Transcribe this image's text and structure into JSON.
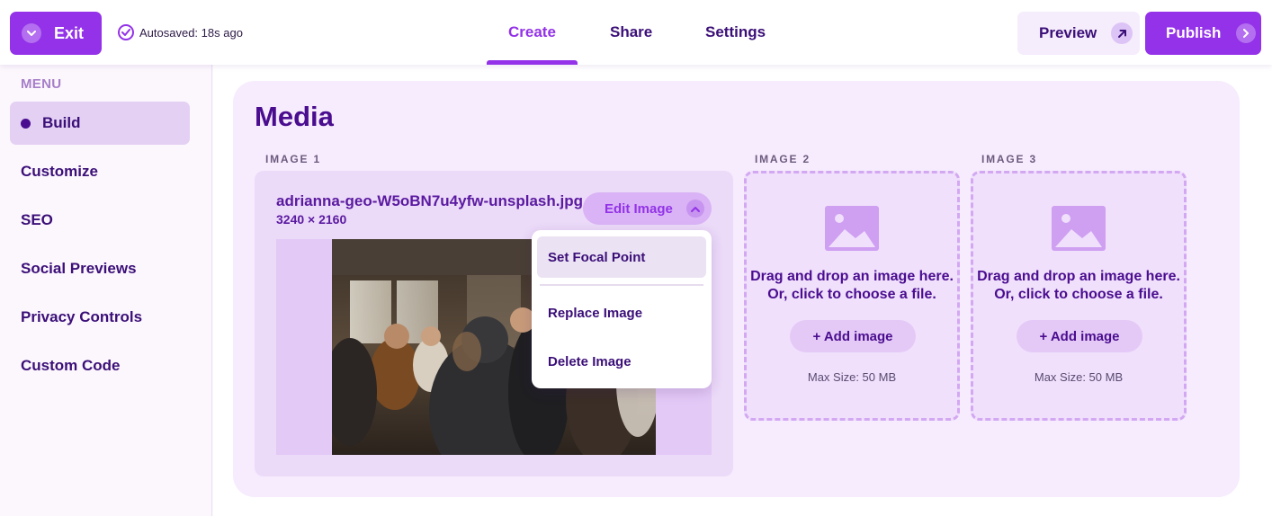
{
  "header": {
    "exit_label": "Exit",
    "autosave_text": "Autosaved: 18s ago",
    "tabs": [
      {
        "label": "Create",
        "active": true
      },
      {
        "label": "Share",
        "active": false
      },
      {
        "label": "Settings",
        "active": false
      }
    ],
    "preview_label": "Preview",
    "publish_label": "Publish"
  },
  "sidebar": {
    "heading": "MENU",
    "items": [
      {
        "label": "Build",
        "active": true
      },
      {
        "label": "Customize",
        "active": false
      },
      {
        "label": "SEO",
        "active": false
      },
      {
        "label": "Social Previews",
        "active": false
      },
      {
        "label": "Privacy Controls",
        "active": false
      },
      {
        "label": "Custom Code",
        "active": false
      }
    ]
  },
  "media": {
    "title": "Media",
    "image1": {
      "label": "IMAGE 1",
      "filename": "adrianna-geo-W5oBN7u4yfw-unsplash.jpg",
      "dimensions": "3240 × 2160",
      "edit_label": "Edit Image"
    },
    "image2": {
      "label": "IMAGE 2",
      "drop_line1": "Drag and drop an image here.",
      "drop_line2": "Or, click to choose a file.",
      "add_label": "+ Add image",
      "max_size": "Max Size: 50 MB"
    },
    "image3": {
      "label": "IMAGE 3",
      "drop_line1": "Drag and drop an image here.",
      "drop_line2": "Or, click to choose a file.",
      "add_label": "+ Add image",
      "max_size": "Max Size: 50 MB"
    }
  },
  "dropdown": {
    "items": [
      "Set Focal Point",
      "Replace Image",
      "Delete Image"
    ]
  },
  "colors": {
    "accent": "#9332e8",
    "text_primary": "#4a0d8f",
    "card_bg": "#f6ecfd"
  },
  "icons": {
    "exit": "chevron-down-icon",
    "autosave": "check-circle-icon",
    "preview": "arrow-up-right-icon",
    "publish": "chevron-right-icon",
    "edit": "chevron-up-icon",
    "dropzone": "image-placeholder-icon"
  }
}
